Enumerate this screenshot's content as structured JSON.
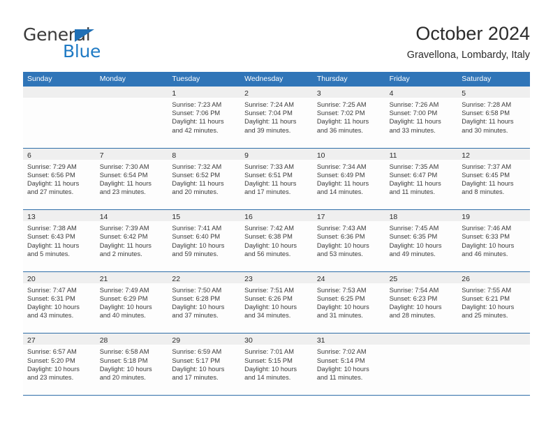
{
  "brand": {
    "name_top": "General",
    "name_bottom": "Blue",
    "triangle_icon": "blue-triangle-logo-mark",
    "color_dark": "#3b3b3b",
    "color_blue": "#1f7ac4"
  },
  "header": {
    "title": "October 2024",
    "subtitle": "Gravellona, Lombardy, Italy"
  },
  "theme": {
    "header_blue": "#3075b8",
    "row_divider_blue": "#2e6da8",
    "day_band_gray": "#efefef"
  },
  "weekdays": [
    "Sunday",
    "Monday",
    "Tuesday",
    "Wednesday",
    "Thursday",
    "Friday",
    "Saturday"
  ],
  "weeks": [
    [
      {
        "day": "",
        "sunrise": "",
        "sunset": "",
        "daylight_1": "",
        "daylight_2": ""
      },
      {
        "day": "",
        "sunrise": "",
        "sunset": "",
        "daylight_1": "",
        "daylight_2": ""
      },
      {
        "day": "1",
        "sunrise": "Sunrise: 7:23 AM",
        "sunset": "Sunset: 7:06 PM",
        "daylight_1": "Daylight: 11 hours",
        "daylight_2": "and 42 minutes."
      },
      {
        "day": "2",
        "sunrise": "Sunrise: 7:24 AM",
        "sunset": "Sunset: 7:04 PM",
        "daylight_1": "Daylight: 11 hours",
        "daylight_2": "and 39 minutes."
      },
      {
        "day": "3",
        "sunrise": "Sunrise: 7:25 AM",
        "sunset": "Sunset: 7:02 PM",
        "daylight_1": "Daylight: 11 hours",
        "daylight_2": "and 36 minutes."
      },
      {
        "day": "4",
        "sunrise": "Sunrise: 7:26 AM",
        "sunset": "Sunset: 7:00 PM",
        "daylight_1": "Daylight: 11 hours",
        "daylight_2": "and 33 minutes."
      },
      {
        "day": "5",
        "sunrise": "Sunrise: 7:28 AM",
        "sunset": "Sunset: 6:58 PM",
        "daylight_1": "Daylight: 11 hours",
        "daylight_2": "and 30 minutes."
      }
    ],
    [
      {
        "day": "6",
        "sunrise": "Sunrise: 7:29 AM",
        "sunset": "Sunset: 6:56 PM",
        "daylight_1": "Daylight: 11 hours",
        "daylight_2": "and 27 minutes."
      },
      {
        "day": "7",
        "sunrise": "Sunrise: 7:30 AM",
        "sunset": "Sunset: 6:54 PM",
        "daylight_1": "Daylight: 11 hours",
        "daylight_2": "and 23 minutes."
      },
      {
        "day": "8",
        "sunrise": "Sunrise: 7:32 AM",
        "sunset": "Sunset: 6:52 PM",
        "daylight_1": "Daylight: 11 hours",
        "daylight_2": "and 20 minutes."
      },
      {
        "day": "9",
        "sunrise": "Sunrise: 7:33 AM",
        "sunset": "Sunset: 6:51 PM",
        "daylight_1": "Daylight: 11 hours",
        "daylight_2": "and 17 minutes."
      },
      {
        "day": "10",
        "sunrise": "Sunrise: 7:34 AM",
        "sunset": "Sunset: 6:49 PM",
        "daylight_1": "Daylight: 11 hours",
        "daylight_2": "and 14 minutes."
      },
      {
        "day": "11",
        "sunrise": "Sunrise: 7:35 AM",
        "sunset": "Sunset: 6:47 PM",
        "daylight_1": "Daylight: 11 hours",
        "daylight_2": "and 11 minutes."
      },
      {
        "day": "12",
        "sunrise": "Sunrise: 7:37 AM",
        "sunset": "Sunset: 6:45 PM",
        "daylight_1": "Daylight: 11 hours",
        "daylight_2": "and 8 minutes."
      }
    ],
    [
      {
        "day": "13",
        "sunrise": "Sunrise: 7:38 AM",
        "sunset": "Sunset: 6:43 PM",
        "daylight_1": "Daylight: 11 hours",
        "daylight_2": "and 5 minutes."
      },
      {
        "day": "14",
        "sunrise": "Sunrise: 7:39 AM",
        "sunset": "Sunset: 6:42 PM",
        "daylight_1": "Daylight: 11 hours",
        "daylight_2": "and 2 minutes."
      },
      {
        "day": "15",
        "sunrise": "Sunrise: 7:41 AM",
        "sunset": "Sunset: 6:40 PM",
        "daylight_1": "Daylight: 10 hours",
        "daylight_2": "and 59 minutes."
      },
      {
        "day": "16",
        "sunrise": "Sunrise: 7:42 AM",
        "sunset": "Sunset: 6:38 PM",
        "daylight_1": "Daylight: 10 hours",
        "daylight_2": "and 56 minutes."
      },
      {
        "day": "17",
        "sunrise": "Sunrise: 7:43 AM",
        "sunset": "Sunset: 6:36 PM",
        "daylight_1": "Daylight: 10 hours",
        "daylight_2": "and 53 minutes."
      },
      {
        "day": "18",
        "sunrise": "Sunrise: 7:45 AM",
        "sunset": "Sunset: 6:35 PM",
        "daylight_1": "Daylight: 10 hours",
        "daylight_2": "and 49 minutes."
      },
      {
        "day": "19",
        "sunrise": "Sunrise: 7:46 AM",
        "sunset": "Sunset: 6:33 PM",
        "daylight_1": "Daylight: 10 hours",
        "daylight_2": "and 46 minutes."
      }
    ],
    [
      {
        "day": "20",
        "sunrise": "Sunrise: 7:47 AM",
        "sunset": "Sunset: 6:31 PM",
        "daylight_1": "Daylight: 10 hours",
        "daylight_2": "and 43 minutes."
      },
      {
        "day": "21",
        "sunrise": "Sunrise: 7:49 AM",
        "sunset": "Sunset: 6:29 PM",
        "daylight_1": "Daylight: 10 hours",
        "daylight_2": "and 40 minutes."
      },
      {
        "day": "22",
        "sunrise": "Sunrise: 7:50 AM",
        "sunset": "Sunset: 6:28 PM",
        "daylight_1": "Daylight: 10 hours",
        "daylight_2": "and 37 minutes."
      },
      {
        "day": "23",
        "sunrise": "Sunrise: 7:51 AM",
        "sunset": "Sunset: 6:26 PM",
        "daylight_1": "Daylight: 10 hours",
        "daylight_2": "and 34 minutes."
      },
      {
        "day": "24",
        "sunrise": "Sunrise: 7:53 AM",
        "sunset": "Sunset: 6:25 PM",
        "daylight_1": "Daylight: 10 hours",
        "daylight_2": "and 31 minutes."
      },
      {
        "day": "25",
        "sunrise": "Sunrise: 7:54 AM",
        "sunset": "Sunset: 6:23 PM",
        "daylight_1": "Daylight: 10 hours",
        "daylight_2": "and 28 minutes."
      },
      {
        "day": "26",
        "sunrise": "Sunrise: 7:55 AM",
        "sunset": "Sunset: 6:21 PM",
        "daylight_1": "Daylight: 10 hours",
        "daylight_2": "and 25 minutes."
      }
    ],
    [
      {
        "day": "27",
        "sunrise": "Sunrise: 6:57 AM",
        "sunset": "Sunset: 5:20 PM",
        "daylight_1": "Daylight: 10 hours",
        "daylight_2": "and 23 minutes."
      },
      {
        "day": "28",
        "sunrise": "Sunrise: 6:58 AM",
        "sunset": "Sunset: 5:18 PM",
        "daylight_1": "Daylight: 10 hours",
        "daylight_2": "and 20 minutes."
      },
      {
        "day": "29",
        "sunrise": "Sunrise: 6:59 AM",
        "sunset": "Sunset: 5:17 PM",
        "daylight_1": "Daylight: 10 hours",
        "daylight_2": "and 17 minutes."
      },
      {
        "day": "30",
        "sunrise": "Sunrise: 7:01 AM",
        "sunset": "Sunset: 5:15 PM",
        "daylight_1": "Daylight: 10 hours",
        "daylight_2": "and 14 minutes."
      },
      {
        "day": "31",
        "sunrise": "Sunrise: 7:02 AM",
        "sunset": "Sunset: 5:14 PM",
        "daylight_1": "Daylight: 10 hours",
        "daylight_2": "and 11 minutes."
      },
      {
        "day": "",
        "sunrise": "",
        "sunset": "",
        "daylight_1": "",
        "daylight_2": ""
      },
      {
        "day": "",
        "sunrise": "",
        "sunset": "",
        "daylight_1": "",
        "daylight_2": ""
      }
    ]
  ]
}
